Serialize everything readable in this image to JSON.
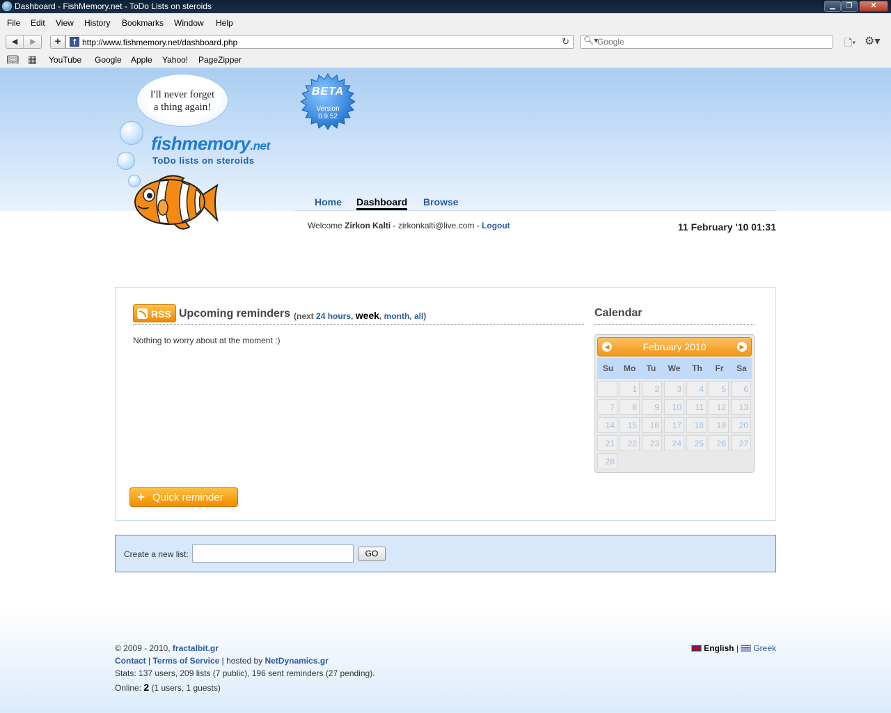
{
  "window": {
    "title": "Dashboard - FishMemory.net - ToDo Lists on steroids",
    "buttons": {
      "minimize": "▁",
      "maximize": "❐",
      "close": "✕"
    }
  },
  "menu": [
    "File",
    "Edit",
    "View",
    "History",
    "Bookmarks",
    "Window",
    "Help"
  ],
  "toolbar": {
    "url": "http://www.fishmemory.net/dashboard.php",
    "search_placeholder": "Google",
    "favicon": "f"
  },
  "bookmarks": [
    "YouTube",
    "Google",
    "Apple",
    "Yahoo!",
    "PageZipper"
  ],
  "header": {
    "cloud_line1": "I'll never forget",
    "cloud_line2": "a thing again!",
    "logo_main": "fishmemory",
    "logo_tld": ".net",
    "logo_sub": "ToDo lists on steroids",
    "beta_label": "BETA",
    "beta_version_label": "Version",
    "beta_version": "0.9.52"
  },
  "nav": {
    "home": "Home",
    "dashboard": "Dashboard",
    "browse": "Browse"
  },
  "user": {
    "welcome": "Welcome",
    "name": "Zirkon Kalti",
    "email_sep": " - zirkonkalti@live.com - ",
    "logout": "Logout",
    "datetime": "11 February '10 01:31"
  },
  "reminders": {
    "rss": "RSS",
    "title": "Upcoming reminders",
    "open": "(next ",
    "f24": "24 hours",
    "fweek": "week",
    "fmonth": "month",
    "fall": "all",
    "empty": "Nothing to worry about at the moment :)",
    "quick": "Quick reminder"
  },
  "calendar": {
    "title": "Calendar",
    "month": "February 2010",
    "prev_icon": "arrow-left-icon",
    "next_icon": "arrow-right-icon",
    "dows": [
      "Su",
      "Mo",
      "Tu",
      "We",
      "Th",
      "Fr",
      "Sa"
    ],
    "first_dow": 1,
    "days": 28
  },
  "newlist": {
    "label": "Create a new list:",
    "go": "GO"
  },
  "footer": {
    "copy": "© 2009 - 2010, ",
    "fractal": "fractalbit.gr",
    "contact": "Contact",
    "terms": "Terms of Service",
    "hosted": " | hosted by ",
    "host": "NetDynamics.gr",
    "stats": "Stats: 137 users, 209 lists (7 public), 196 sent reminders (27 pending).",
    "online_label": "Online: ",
    "online_count": "2",
    "online_detail": " (1 users, 1 guests)",
    "lang_en": "English",
    "lang_gr": "Greek"
  },
  "colors": {
    "accent": "#2a5a9e",
    "orange": "#f28c00",
    "header_blue": "#a9cdf2"
  }
}
